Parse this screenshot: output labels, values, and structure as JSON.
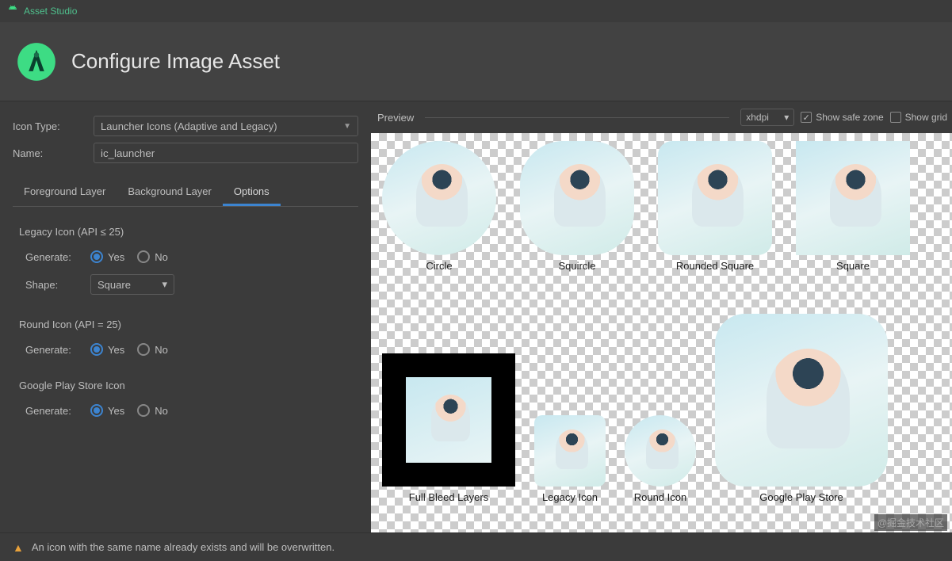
{
  "window": {
    "title": "Asset Studio"
  },
  "header": {
    "title": "Configure Image Asset"
  },
  "form": {
    "icon_type_label": "Icon Type:",
    "icon_type_value": "Launcher Icons (Adaptive and Legacy)",
    "name_label": "Name:",
    "name_value": "ic_launcher"
  },
  "tabs": {
    "foreground": "Foreground Layer",
    "background": "Background Layer",
    "options": "Options",
    "active": "options"
  },
  "options": {
    "legacy_title": "Legacy Icon (API ≤ 25)",
    "round_title": "Round Icon (API = 25)",
    "gplay_title": "Google Play Store Icon",
    "generate_label": "Generate:",
    "shape_label": "Shape:",
    "shape_value": "Square",
    "yes": "Yes",
    "no": "No",
    "legacy_generate": "Yes",
    "round_generate": "Yes",
    "gplay_generate": "Yes"
  },
  "preview": {
    "label": "Preview",
    "density": "xhdpi",
    "show_safe_zone_label": "Show safe zone",
    "show_safe_zone": true,
    "show_grid_label": "Show grid",
    "show_grid": false,
    "tiles": {
      "circle": "Circle",
      "squircle": "Squircle",
      "rounded_square": "Rounded Square",
      "square": "Square",
      "full_bleed": "Full Bleed Layers",
      "legacy": "Legacy Icon",
      "round": "Round Icon",
      "gplay": "Google Play Store"
    }
  },
  "footer": {
    "warning": "An icon with the same name already exists and will be overwritten."
  },
  "watermark": "@掘金技术社区"
}
